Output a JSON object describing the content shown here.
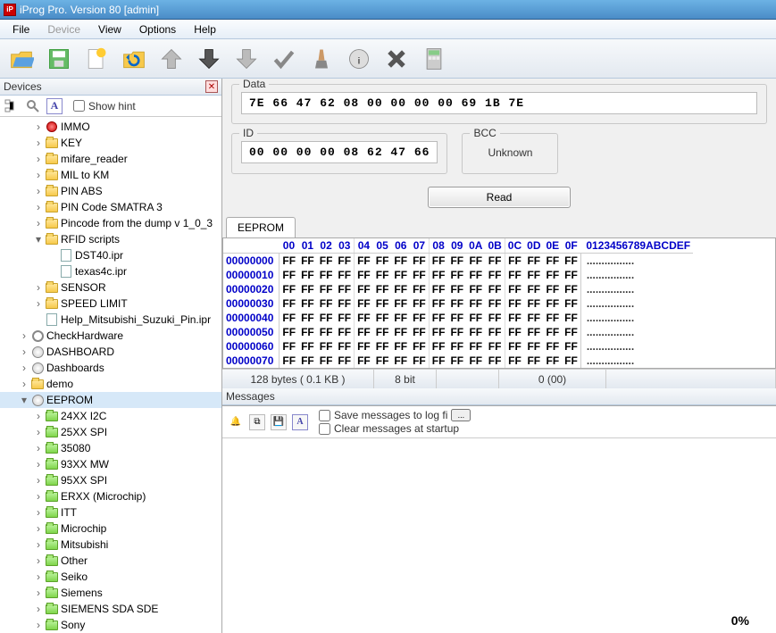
{
  "title": "iProg Pro. Version 80 [admin]",
  "menu": {
    "file": "File",
    "device": "Device",
    "view": "View",
    "options": "Options",
    "help": "Help"
  },
  "devices": {
    "panel_title": "Devices",
    "show_hint": "Show hint",
    "tree": [
      {
        "level": 2,
        "icon": "immo",
        "label": "IMMO",
        "twisty": "›"
      },
      {
        "level": 2,
        "icon": "folder",
        "label": "KEY",
        "twisty": "›"
      },
      {
        "level": 2,
        "icon": "folder",
        "label": "mifare_reader",
        "twisty": "›"
      },
      {
        "level": 2,
        "icon": "folder",
        "label": "MIL to KM",
        "twisty": "›"
      },
      {
        "level": 2,
        "icon": "folder",
        "label": "PIN ABS",
        "twisty": "›"
      },
      {
        "level": 2,
        "icon": "folder",
        "label": "PIN Code SMATRA 3",
        "twisty": "›"
      },
      {
        "level": 2,
        "icon": "folder",
        "label": "Pincode from the dump v 1_0_3",
        "twisty": "›"
      },
      {
        "level": 2,
        "icon": "folder",
        "label": "RFID scripts",
        "twisty": "▾"
      },
      {
        "level": 3,
        "icon": "doc",
        "label": "DST40.ipr",
        "twisty": ""
      },
      {
        "level": 3,
        "icon": "doc",
        "label": "texas4c.ipr",
        "twisty": ""
      },
      {
        "level": 2,
        "icon": "folder",
        "label": "SENSOR",
        "twisty": "›"
      },
      {
        "level": 2,
        "icon": "folder",
        "label": "SPEED LIMIT",
        "twisty": "›"
      },
      {
        "level": 2,
        "icon": "doc",
        "label": "Help_Mitsubishi_Suzuki_Pin.ipr",
        "twisty": ""
      },
      {
        "level": 1,
        "icon": "gear",
        "label": "CheckHardware",
        "twisty": "›"
      },
      {
        "level": 1,
        "icon": "dash",
        "label": "DASHBOARD",
        "twisty": "›"
      },
      {
        "level": 1,
        "icon": "dash",
        "label": "Dashboards",
        "twisty": "›"
      },
      {
        "level": 1,
        "icon": "folder",
        "label": "demo",
        "twisty": "›"
      },
      {
        "level": 1,
        "icon": "dash",
        "label": "EEPROM",
        "twisty": "▾",
        "selected": true
      },
      {
        "level": 2,
        "icon": "folder-green",
        "label": "24XX I2C",
        "twisty": "›"
      },
      {
        "level": 2,
        "icon": "folder-green",
        "label": "25XX SPI",
        "twisty": "›"
      },
      {
        "level": 2,
        "icon": "folder-green",
        "label": "35080",
        "twisty": "›"
      },
      {
        "level": 2,
        "icon": "folder-green",
        "label": "93XX MW",
        "twisty": "›"
      },
      {
        "level": 2,
        "icon": "folder-green",
        "label": "95XX SPI",
        "twisty": "›"
      },
      {
        "level": 2,
        "icon": "folder-green",
        "label": "ERXX (Microchip)",
        "twisty": "›"
      },
      {
        "level": 2,
        "icon": "folder-green",
        "label": "ITT",
        "twisty": "›"
      },
      {
        "level": 2,
        "icon": "folder-green",
        "label": "Microchip",
        "twisty": "›"
      },
      {
        "level": 2,
        "icon": "folder-green",
        "label": "Mitsubishi",
        "twisty": "›"
      },
      {
        "level": 2,
        "icon": "folder-green",
        "label": "Other",
        "twisty": "›"
      },
      {
        "level": 2,
        "icon": "folder-green",
        "label": "Seiko",
        "twisty": "›"
      },
      {
        "level": 2,
        "icon": "folder-green",
        "label": "Siemens",
        "twisty": "›"
      },
      {
        "level": 2,
        "icon": "folder-green",
        "label": "SIEMENS SDA SDE",
        "twisty": "›"
      },
      {
        "level": 2,
        "icon": "folder-green",
        "label": "Sony",
        "twisty": "›"
      }
    ]
  },
  "data_box": {
    "legend": "Data",
    "value": "7E 66 47 62 08 00 00 00 00 69 1B 7E"
  },
  "id_box": {
    "legend": "ID",
    "value": "00 00 00 00 08 62 47 66"
  },
  "bcc_box": {
    "legend": "BCC",
    "value": "Unknown"
  },
  "read_btn": "Read",
  "tab": "EEPROM",
  "hex": {
    "cols": [
      "00",
      "01",
      "02",
      "03",
      "04",
      "05",
      "06",
      "07",
      "08",
      "09",
      "0A",
      "0B",
      "0C",
      "0D",
      "0E",
      "0F"
    ],
    "ascii_head": "0123456789ABCDEF",
    "rows": [
      {
        "addr": "00000000",
        "vals": [
          "FF",
          "FF",
          "FF",
          "FF",
          "FF",
          "FF",
          "FF",
          "FF",
          "FF",
          "FF",
          "FF",
          "FF",
          "FF",
          "FF",
          "FF",
          "FF"
        ],
        "ascii": "................"
      },
      {
        "addr": "00000010",
        "vals": [
          "FF",
          "FF",
          "FF",
          "FF",
          "FF",
          "FF",
          "FF",
          "FF",
          "FF",
          "FF",
          "FF",
          "FF",
          "FF",
          "FF",
          "FF",
          "FF"
        ],
        "ascii": "................"
      },
      {
        "addr": "00000020",
        "vals": [
          "FF",
          "FF",
          "FF",
          "FF",
          "FF",
          "FF",
          "FF",
          "FF",
          "FF",
          "FF",
          "FF",
          "FF",
          "FF",
          "FF",
          "FF",
          "FF"
        ],
        "ascii": "................"
      },
      {
        "addr": "00000030",
        "vals": [
          "FF",
          "FF",
          "FF",
          "FF",
          "FF",
          "FF",
          "FF",
          "FF",
          "FF",
          "FF",
          "FF",
          "FF",
          "FF",
          "FF",
          "FF",
          "FF"
        ],
        "ascii": "................"
      },
      {
        "addr": "00000040",
        "vals": [
          "FF",
          "FF",
          "FF",
          "FF",
          "FF",
          "FF",
          "FF",
          "FF",
          "FF",
          "FF",
          "FF",
          "FF",
          "FF",
          "FF",
          "FF",
          "FF"
        ],
        "ascii": "................"
      },
      {
        "addr": "00000050",
        "vals": [
          "FF",
          "FF",
          "FF",
          "FF",
          "FF",
          "FF",
          "FF",
          "FF",
          "FF",
          "FF",
          "FF",
          "FF",
          "FF",
          "FF",
          "FF",
          "FF"
        ],
        "ascii": "................"
      },
      {
        "addr": "00000060",
        "vals": [
          "FF",
          "FF",
          "FF",
          "FF",
          "FF",
          "FF",
          "FF",
          "FF",
          "FF",
          "FF",
          "FF",
          "FF",
          "FF",
          "FF",
          "FF",
          "FF"
        ],
        "ascii": "................"
      },
      {
        "addr": "00000070",
        "vals": [
          "FF",
          "FF",
          "FF",
          "FF",
          "FF",
          "FF",
          "FF",
          "FF",
          "FF",
          "FF",
          "FF",
          "FF",
          "FF",
          "FF",
          "FF",
          "FF"
        ],
        "ascii": "................"
      }
    ]
  },
  "status": {
    "size": "128 bytes ( 0.1 KB )",
    "bits": "8 bit",
    "crc": "0 (00)"
  },
  "messages": {
    "panel_title": "Messages",
    "save_log": "Save messages to log fi",
    "clear_startup": "Clear messages at startup",
    "pct": "0%"
  }
}
